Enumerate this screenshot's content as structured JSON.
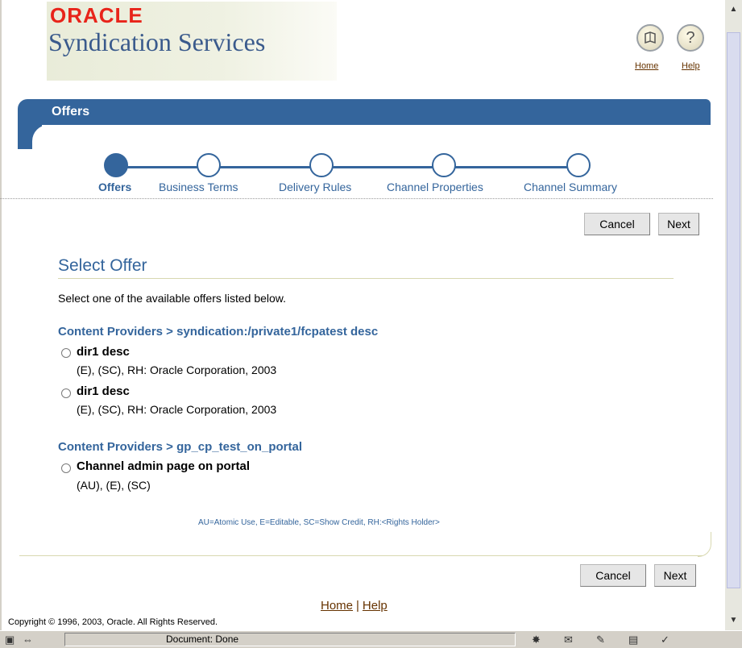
{
  "header": {
    "oracle_logo_text": "ORACLE",
    "app_title": "Syndication Services",
    "global_links": [
      {
        "label": "Home"
      },
      {
        "label": "Help"
      }
    ]
  },
  "title_bar": {
    "label": "Offers"
  },
  "train": {
    "steps": [
      {
        "label": "Offers",
        "active": true
      },
      {
        "label": "Business Terms",
        "active": false
      },
      {
        "label": "Delivery Rules",
        "active": false
      },
      {
        "label": "Channel Properties",
        "active": false
      },
      {
        "label": "Channel Summary",
        "active": false
      }
    ]
  },
  "buttons": {
    "cancel": "Cancel",
    "next": "Next"
  },
  "content": {
    "section_title": "Select Offer",
    "instruction": "Select one of the available offers listed below.",
    "groups": [
      {
        "header": "Content Providers > syndication:/private1/fcpatest desc",
        "options": [
          {
            "name": "dir1 desc",
            "detail": "(E), (SC), RH: Oracle Corporation, 2003"
          },
          {
            "name": "dir1 desc",
            "detail": "(E), (SC), RH: Oracle Corporation, 2003"
          }
        ]
      },
      {
        "header": "Content Providers > gp_cp_test_on_portal",
        "options": [
          {
            "name": "Channel admin page on portal",
            "detail": "(AU), (E), (SC)"
          }
        ]
      }
    ],
    "legend": "AU=Atomic Use, E=Editable, SC=Show Credit, RH:<Rights Holder>"
  },
  "footer": {
    "links": [
      {
        "label": "Home"
      },
      {
        "label": "Help"
      }
    ],
    "separator": "|",
    "copyright": "Copyright © 1996, 2003, Oracle. All Rights Reserved."
  },
  "statusbar": {
    "text": "Document: Done"
  },
  "colors": {
    "brand_blue": "#34659c",
    "oracle_red": "#e8241a",
    "link_brown": "#663300"
  }
}
